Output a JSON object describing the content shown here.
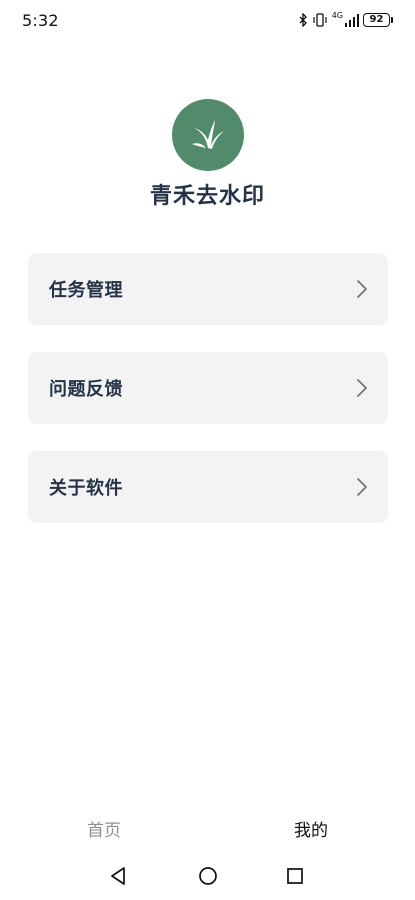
{
  "status_bar": {
    "time": "5:32",
    "network": "4G",
    "battery": "92"
  },
  "header": {
    "logo_icon": "grass-sprout-icon",
    "app_name": "青禾去水印"
  },
  "menu": {
    "items": [
      {
        "label": "任务管理",
        "icon": "chevron-right-icon"
      },
      {
        "label": "问题反馈",
        "icon": "chevron-right-icon"
      },
      {
        "label": "关于软件",
        "icon": "chevron-right-icon"
      }
    ]
  },
  "tab_bar": {
    "tabs": [
      {
        "label": "首页",
        "active": false
      },
      {
        "label": "我的",
        "active": true
      }
    ]
  },
  "system_nav": {
    "buttons": [
      "back-icon",
      "home-icon",
      "recents-icon"
    ]
  },
  "colors": {
    "logo_bg": "#528a6c",
    "card_bg": "#f3f3f4",
    "title_text": "#243348",
    "inactive_tab": "#8c8f94"
  }
}
